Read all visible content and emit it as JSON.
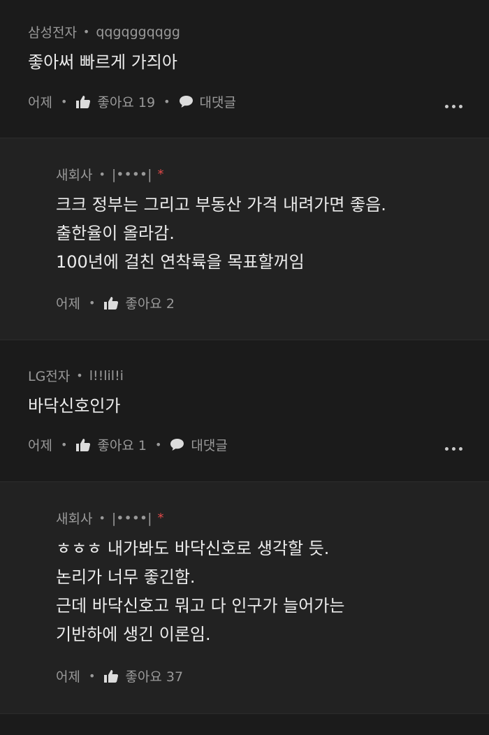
{
  "comments": [
    {
      "author": "삼성전자",
      "nickname": "qqgqggqqgg",
      "text": [
        "좋아써 빠르게 가즤아"
      ],
      "time": "어제",
      "like_label": "좋아요 19",
      "reply_label": "대댓글"
    },
    {
      "author": "새회사",
      "nickname": "|••••|",
      "badge": "*",
      "text": [
        "크크 정부는 그리고 부동산 가격 내려가면 좋음.",
        "출한율이 올라감.",
        "100년에 걸친 연착륙을 목표할꺼임"
      ],
      "time": "어제",
      "like_label": "좋아요 2"
    },
    {
      "author": "LG전자",
      "nickname": "l!!lil!i",
      "text": [
        "바닥신호인가"
      ],
      "time": "어제",
      "like_label": "좋아요 1",
      "reply_label": "대댓글"
    },
    {
      "author": "새회사",
      "nickname": "|••••|",
      "badge": "*",
      "text": [
        "ㅎㅎㅎ 내가봐도 바닥신호로 생각할 듯.",
        "논리가 너무 좋긴함.",
        "근데 바닥신호고 뭐고 다 인구가 늘어가는",
        "기반하에 생긴 이론임."
      ],
      "time": "어제",
      "like_label": "좋아요 37"
    }
  ],
  "separator": "•",
  "icons": {
    "like": "thumbs-up-icon",
    "reply": "speech-bubble-icon",
    "more": "more-dots-icon"
  },
  "colors": {
    "background": "#1b1b1b",
    "reply_background": "#222222",
    "meta_text": "#9a9a9a",
    "body_text": "#ececec",
    "badge": "#e04848"
  }
}
